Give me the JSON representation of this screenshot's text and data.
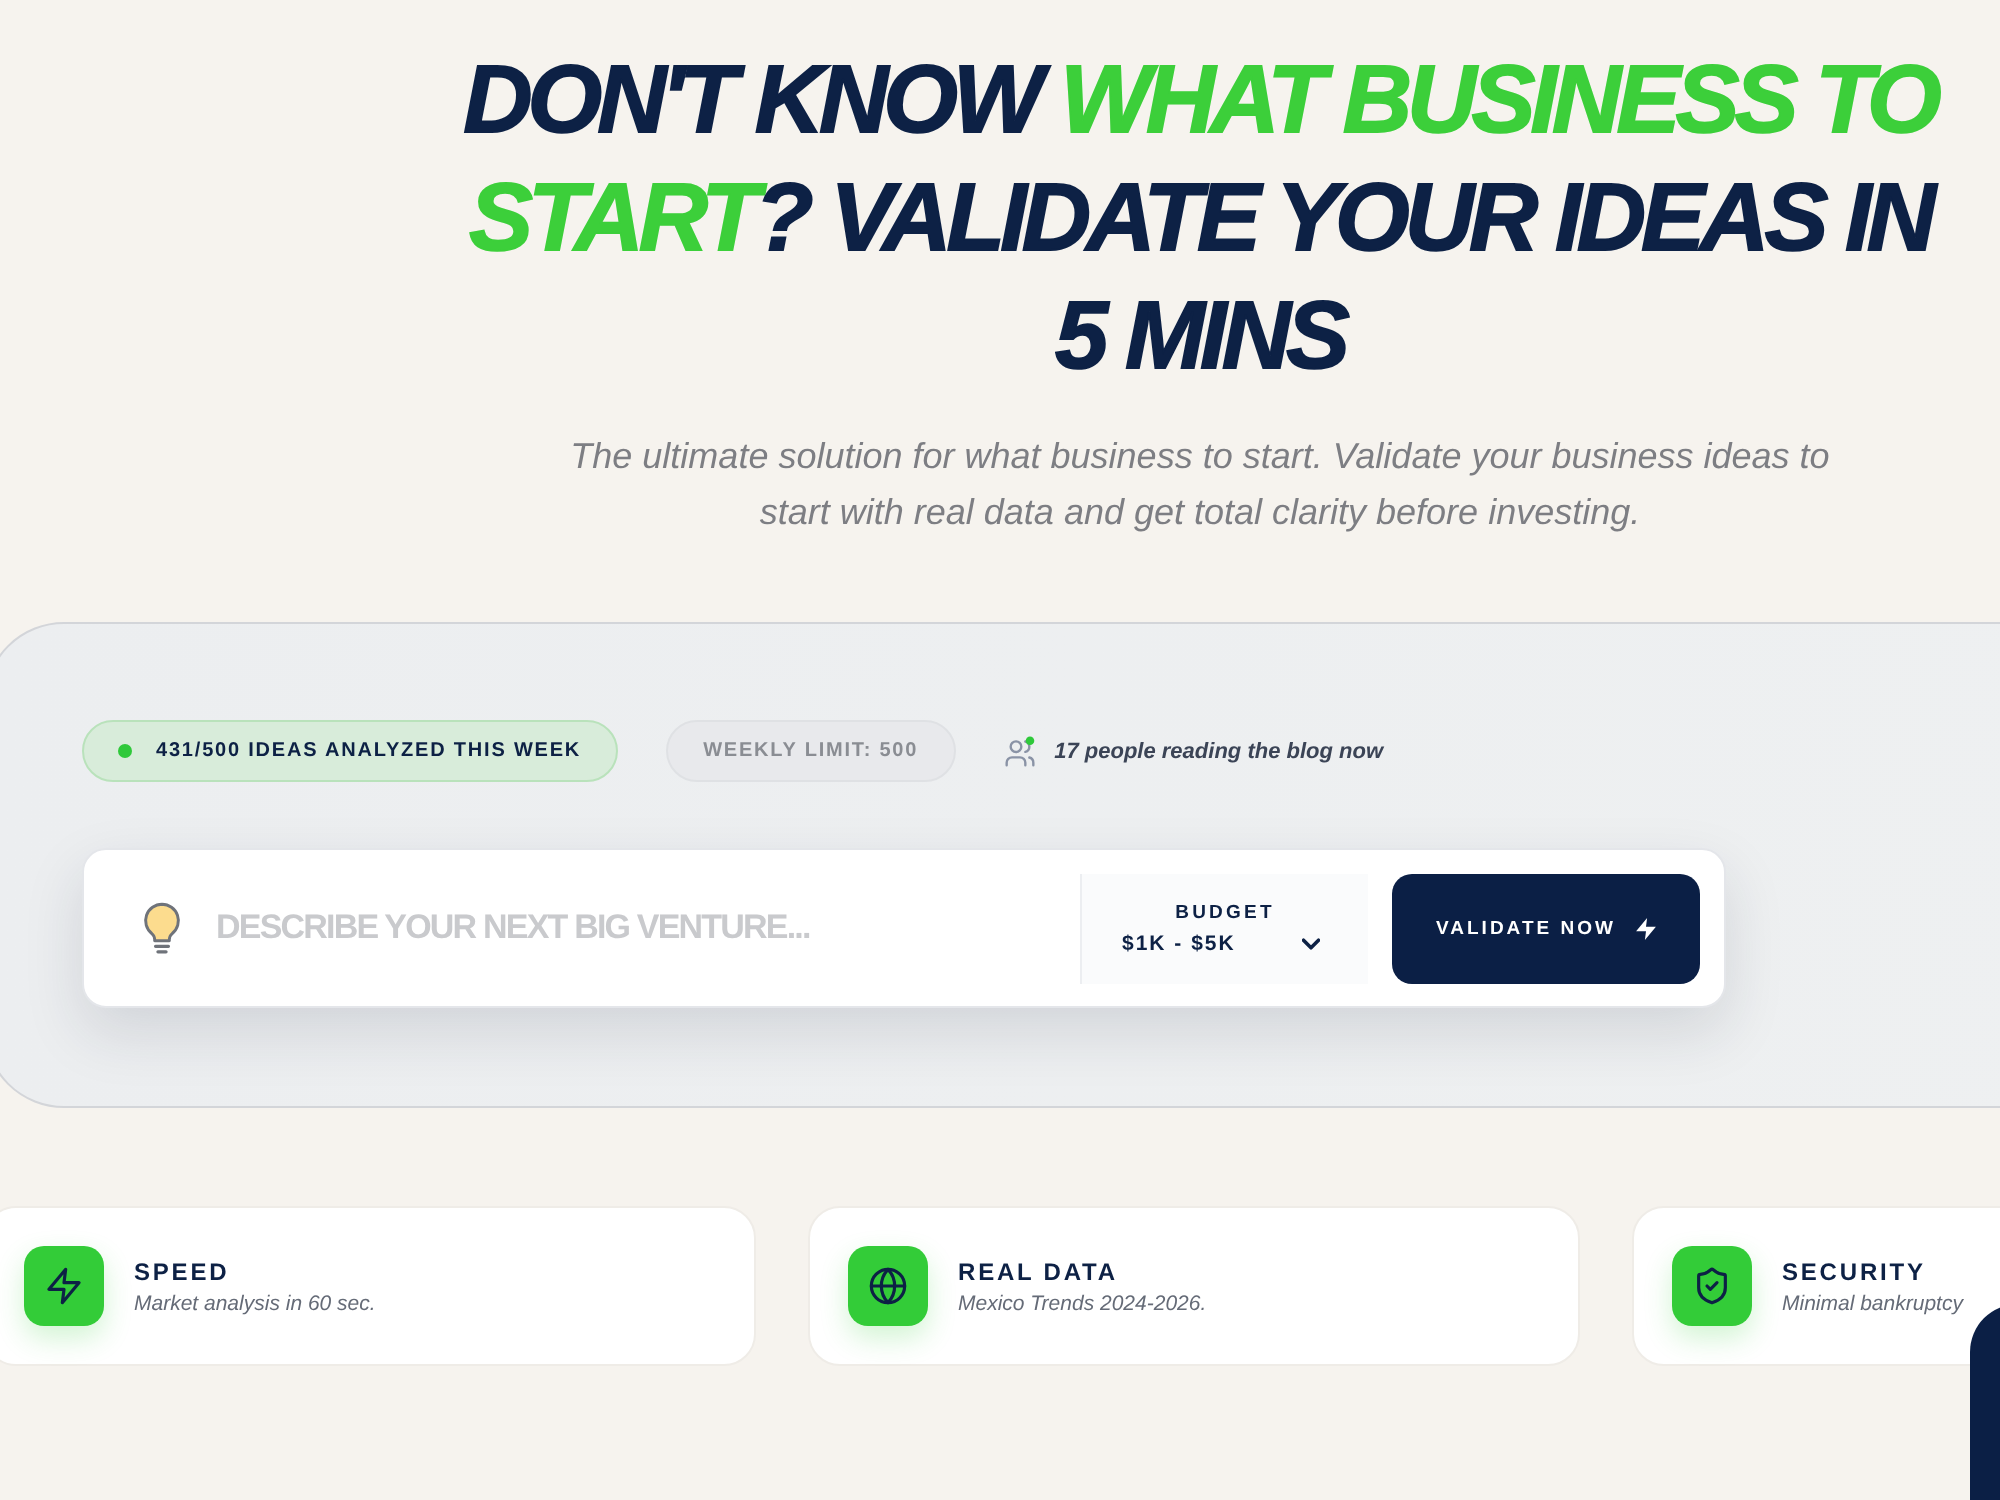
{
  "headline": {
    "segments": [
      {
        "text": "DON'T KNOW ",
        "highlight": false
      },
      {
        "text": "WHAT BUSINESS TO START",
        "highlight": true
      },
      {
        "text": "? VALIDATE YOUR IDEAS IN 5 MINS",
        "highlight": false
      }
    ]
  },
  "subtitle": "The ultimate solution for what business to start. Validate your business ideas to start with real data and get total clarity before investing.",
  "stats": {
    "badges": [
      {
        "kind": "progress",
        "text": "431/500 IDEAS ANALYZED THIS WEEK"
      },
      {
        "kind": "limit",
        "text": "WEEKLY LIMIT: 500"
      }
    ],
    "readers": "17 people reading the blog now"
  },
  "search": {
    "placeholder": "DESCRIBE YOUR NEXT BIG VENTURE...",
    "budget_label": "BUDGET",
    "budget_value": "$1K - $5K",
    "button": "VALIDATE NOW"
  },
  "features": [
    {
      "kind": "speed",
      "title": "SPEED",
      "description": "Market analysis in 60 sec."
    },
    {
      "kind": "data",
      "title": "REAL DATA",
      "description": "Mexico Trends 2024-2026."
    },
    {
      "kind": "security",
      "title": "SECURITY",
      "description": "Minimal bankruptcy"
    }
  ]
}
